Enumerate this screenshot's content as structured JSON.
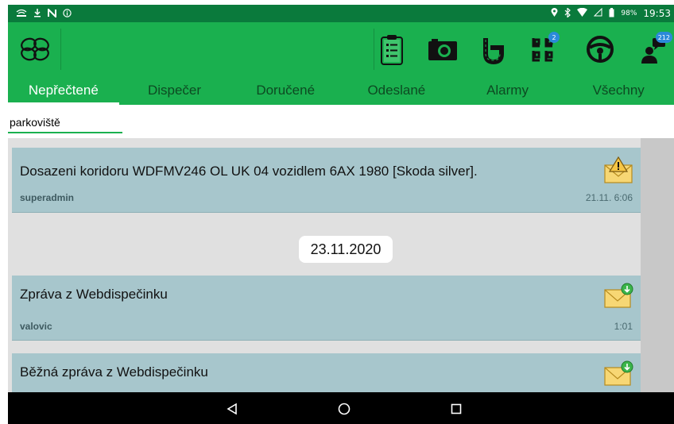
{
  "status_bar": {
    "left_icons": [
      "signal-quality-icon",
      "download-icon",
      "n-icon",
      "info-icon"
    ],
    "right_icons": [
      "location-icon",
      "bluetooth-icon",
      "wifi-icon",
      "cellular-icon",
      "battery-icon"
    ],
    "battery": "98%",
    "time": "19:53"
  },
  "toolbar": {
    "icons": [
      {
        "name": "checklist-icon"
      },
      {
        "name": "camera-icon"
      },
      {
        "name": "route-icon"
      },
      {
        "name": "parking-icon",
        "badge": "2"
      },
      {
        "name": "steering-wheel-icon"
      },
      {
        "name": "driver-messages-icon",
        "badge": "212"
      }
    ]
  },
  "tabs": [
    "Nepřečtené",
    "Dispečer",
    "Doručené",
    "Odeslané",
    "Alarmy",
    "Všechny"
  ],
  "active_tab": 0,
  "search": {
    "value": "parkoviště"
  },
  "messages": [
    {
      "title": "Dosazeni koridoru WDFMV246 OL UK 04 vozidlem 6AX 1980 [Skoda silver].",
      "author": "superadmin",
      "time": "21.11. 6:06",
      "icon": "warning-envelope-icon"
    },
    {
      "title": "Zpráva z Webdispečinku",
      "author": "valovic",
      "time": "1:01",
      "icon": "download-envelope-icon"
    },
    {
      "title": "Běžná zpráva z Webdispečinku",
      "author": "",
      "time": "",
      "icon": "download-envelope-icon"
    }
  ],
  "date_separator": "23.11.2020",
  "colors": {
    "status_bar": "#0a7a3c",
    "primary": "#1ab04f",
    "card": "#a7c6cc",
    "background": "#e0e0e0"
  },
  "nav": [
    "back-icon",
    "home-icon",
    "recents-icon"
  ]
}
